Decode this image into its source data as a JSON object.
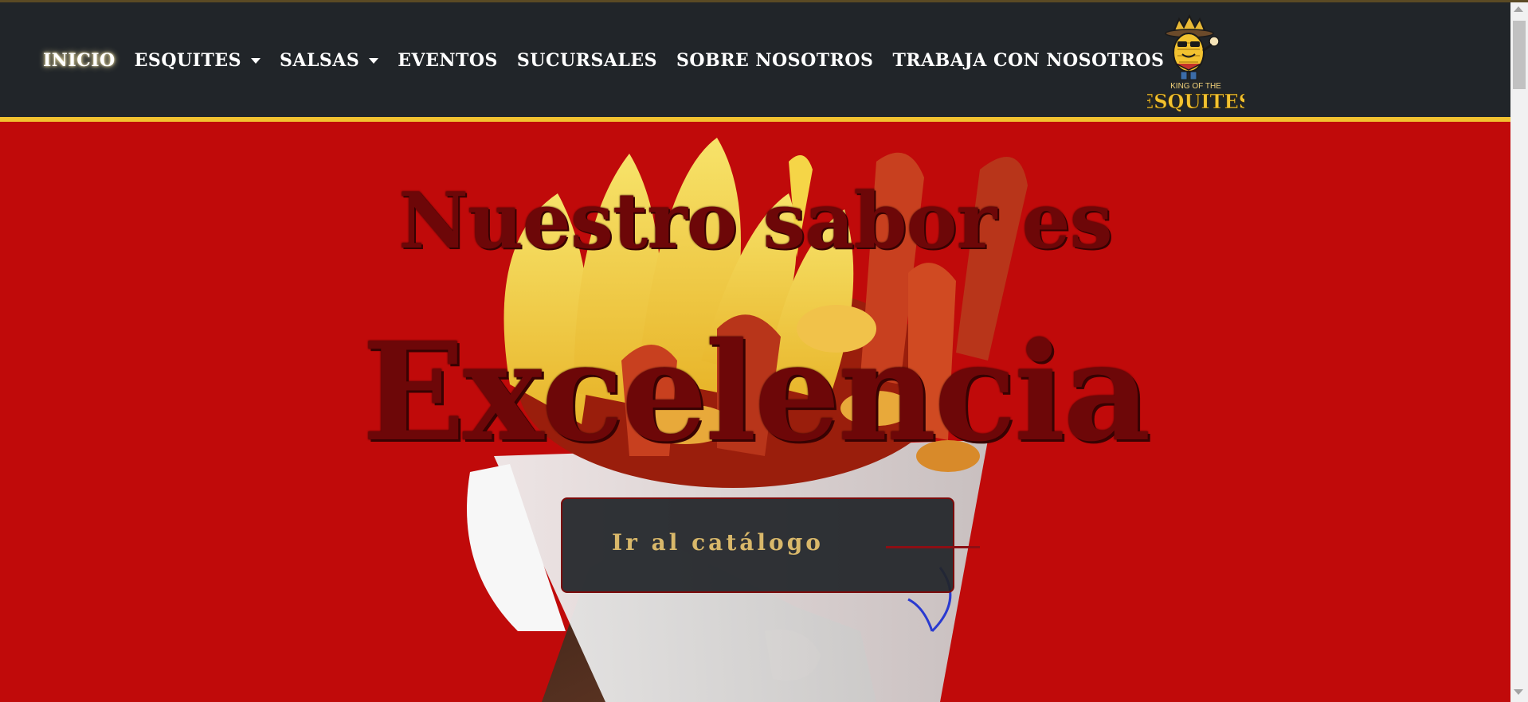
{
  "nav": {
    "items": [
      {
        "label": "INICIO",
        "active": true,
        "dropdown": false
      },
      {
        "label": "ESQUITES",
        "active": false,
        "dropdown": true
      },
      {
        "label": "SALSAS",
        "active": false,
        "dropdown": true
      },
      {
        "label": "EVENTOS",
        "active": false,
        "dropdown": false
      },
      {
        "label": "SUCURSALES",
        "active": false,
        "dropdown": false
      },
      {
        "label": "SOBRE NOSOTROS",
        "active": false,
        "dropdown": false
      },
      {
        "label": "TRABAJA CON NOSOTROS",
        "active": false,
        "dropdown": false
      }
    ]
  },
  "logo": {
    "line1": "KING OF THE",
    "line2": "ESQUITES"
  },
  "hero": {
    "title_line1": "Nuestro sabor es",
    "title_line2": "Excelencia",
    "cta_label": "Ir al catálogo"
  },
  "colors": {
    "navbar_bg": "#212529",
    "accent_yellow": "#f2c230",
    "hero_red": "#c00a0a",
    "title_dark_red": "#6d0708",
    "cta_text": "#d9b86a"
  }
}
